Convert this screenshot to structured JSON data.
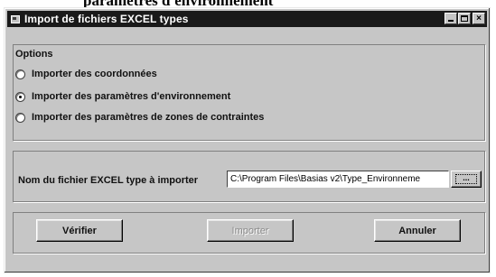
{
  "page_header": "paramètres d'environnement",
  "window": {
    "title": "Import de fichiers EXCEL types",
    "controls": {
      "minimize": "_",
      "maximize": "□",
      "close": "×"
    }
  },
  "options": {
    "legend": "Options",
    "items": [
      {
        "label": "Importer des coordonnées",
        "checked": false
      },
      {
        "label": "Importer des paramètres d'environnement",
        "checked": true
      },
      {
        "label": "Importer des paramètres de zones de contraintes",
        "checked": false
      }
    ]
  },
  "file": {
    "label": "Nom du fichier EXCEL type à importer",
    "value": "C:\\Program Files\\Basias v2\\Type_Environneme",
    "browse_label": "..."
  },
  "buttons": {
    "verify": "Vérifier",
    "import": "Importer",
    "cancel": "Annuler"
  }
}
